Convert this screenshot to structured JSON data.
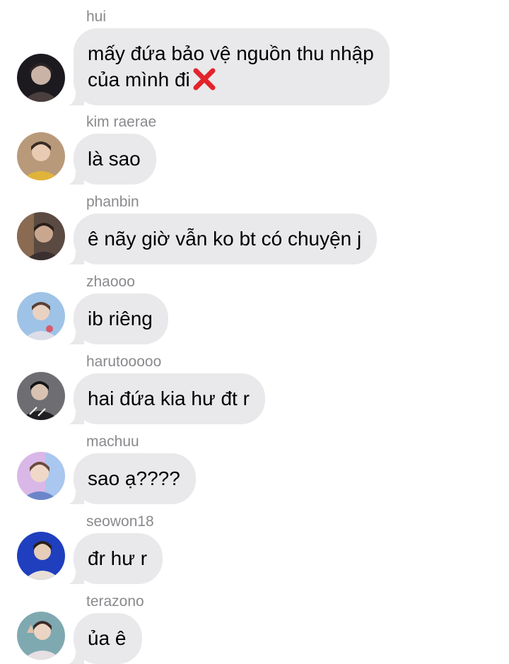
{
  "messages": [
    {
      "sender": "hui",
      "lines": [
        "mấy đứa bảo vệ nguồn thu nhập",
        "của mình đi"
      ],
      "trailing_icon": "cross-mark-icon",
      "avatar_colors": [
        "#1c1a1f",
        "#4a3f3d"
      ]
    },
    {
      "sender": "kim raerae",
      "lines": [
        "là sao"
      ],
      "avatar_colors": [
        "#b89a7a",
        "#e0b43a"
      ]
    },
    {
      "sender": "phanbin",
      "lines": [
        "ê nãy giờ vẫn ko bt có chuyện j"
      ],
      "avatar_colors": [
        "#5b4a42",
        "#c9a78f"
      ]
    },
    {
      "sender": "zhaooo",
      "lines": [
        "ib riêng"
      ],
      "avatar_colors": [
        "#9ec3e6",
        "#dcdde8"
      ]
    },
    {
      "sender": "harutooooo",
      "lines": [
        "hai đứa kia hư đt r"
      ],
      "avatar_colors": [
        "#6e6e72",
        "#1f1f22"
      ]
    },
    {
      "sender": "machuu",
      "lines": [
        "sao ạ????"
      ],
      "avatar_colors": [
        "#d9b8e8",
        "#6a86c9"
      ]
    },
    {
      "sender": "seowon18",
      "lines": [
        "đr hư r"
      ],
      "avatar_colors": [
        "#1f3fbf",
        "#e8e0d8"
      ]
    },
    {
      "sender": "terazono",
      "lines": [
        "ủa ê"
      ],
      "avatar_colors": [
        "#7fa9b0",
        "#e6dfe3"
      ]
    }
  ],
  "colors": {
    "bubble": "#e9e9eb",
    "sender_name": "#8a8a8e",
    "text": "#000000",
    "cross_mark": "#e3232b"
  }
}
